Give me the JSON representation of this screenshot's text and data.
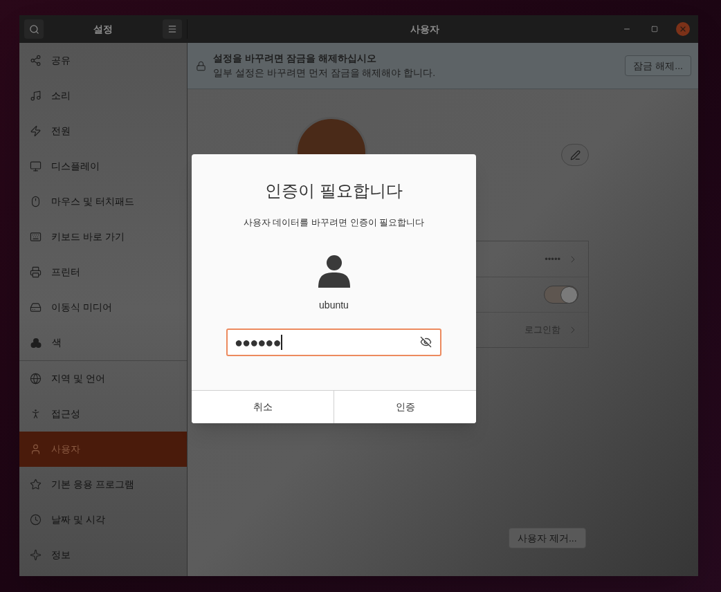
{
  "window": {
    "title": "사용자",
    "sidebar_title": "설정"
  },
  "sidebar": {
    "sections": [
      {
        "items": [
          {
            "label": "공유",
            "selected": false
          },
          {
            "label": "소리",
            "selected": false
          },
          {
            "label": "전원",
            "selected": false
          },
          {
            "label": "디스플레이",
            "selected": false
          },
          {
            "label": "마우스 및 터치패드",
            "selected": false
          },
          {
            "label": "키보드 바로 가기",
            "selected": false
          },
          {
            "label": "프린터",
            "selected": false
          },
          {
            "label": "이동식 미디어",
            "selected": false
          },
          {
            "label": "색",
            "selected": false
          }
        ]
      },
      {
        "items": [
          {
            "label": "지역 및 언어",
            "selected": false
          },
          {
            "label": "접근성",
            "selected": false
          },
          {
            "label": "사용자",
            "selected": true
          },
          {
            "label": "기본 응용 프로그램",
            "selected": false
          },
          {
            "label": "날짜 및 시각",
            "selected": false
          },
          {
            "label": "정보",
            "selected": false
          }
        ]
      }
    ]
  },
  "lock_banner": {
    "title": "설정을 바꾸려면 잠금을 해제하십시오",
    "subtitle": "일부 설정은 바꾸려면 먼저 잠금을 해제해야 합니다.",
    "button": "잠금 해제..."
  },
  "user": {
    "rows": [
      {
        "kind": "value",
        "value": "•••••"
      },
      {
        "kind": "toggle",
        "on": true
      },
      {
        "kind": "value",
        "value": "로그인함"
      }
    ],
    "remove_button": {
      "label": "사용자 제거...",
      "disabled": true
    }
  },
  "dialog": {
    "title": "인증이 필요합니다",
    "message": "사용자 데이터를 바꾸려면 인증이 필요합니다",
    "username": "ubuntu",
    "password": {
      "value": "●●●●●●",
      "focused": true
    },
    "buttons": [
      "취소",
      "인증"
    ]
  }
}
